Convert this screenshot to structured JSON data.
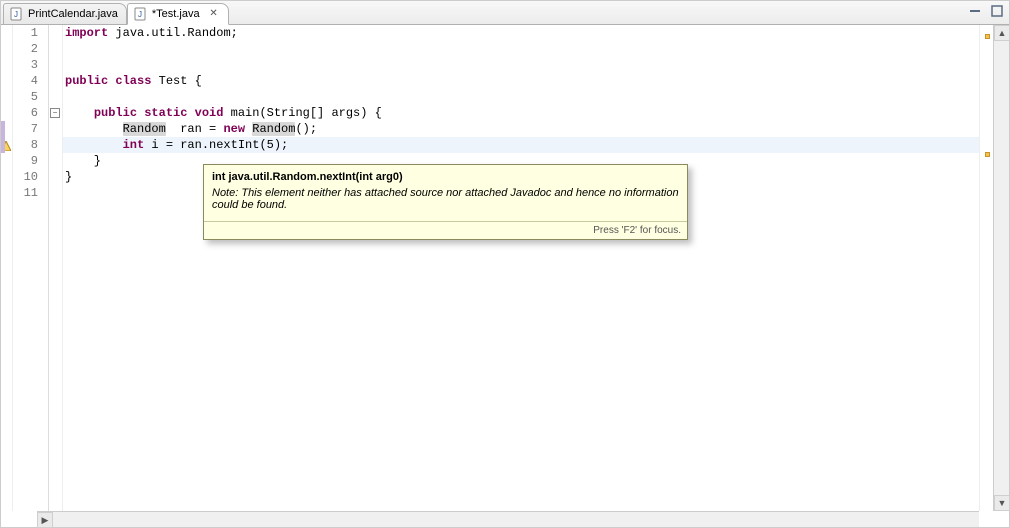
{
  "tabs": [
    {
      "label": "PrintCalendar.java",
      "active": false,
      "dirty": false,
      "closable": false
    },
    {
      "label": "*Test.java",
      "active": true,
      "dirty": true,
      "closable": true
    }
  ],
  "controls": {
    "maximize_name": "maximize-icon",
    "minimize_name": "minimize-icon"
  },
  "code": {
    "lines": [
      {
        "n": 1,
        "fold": null,
        "warn": false,
        "change": false,
        "hl": false,
        "tokens": [
          [
            "imp",
            "import "
          ],
          [
            "pkg",
            "java.util.Random"
          ],
          [
            "",
            ";"
          ]
        ]
      },
      {
        "n": 2,
        "fold": null,
        "warn": false,
        "change": false,
        "hl": false,
        "tokens": []
      },
      {
        "n": 3,
        "fold": null,
        "warn": false,
        "change": false,
        "hl": false,
        "tokens": []
      },
      {
        "n": 4,
        "fold": null,
        "warn": false,
        "change": false,
        "hl": false,
        "tokens": [
          [
            "kw",
            "public class "
          ],
          [
            "cls",
            "Test"
          ],
          [
            "",
            " {"
          ]
        ]
      },
      {
        "n": 5,
        "fold": null,
        "warn": false,
        "change": false,
        "hl": false,
        "tokens": []
      },
      {
        "n": 6,
        "fold": "minus",
        "warn": false,
        "change": false,
        "hl": false,
        "tokens": [
          [
            "",
            "    "
          ],
          [
            "kw",
            "public static void "
          ],
          [
            "",
            "main(String[] args) {"
          ]
        ]
      },
      {
        "n": 7,
        "fold": null,
        "warn": false,
        "change": true,
        "hl": false,
        "tokens": [
          [
            "",
            "        "
          ],
          [
            "occ",
            "Random"
          ],
          [
            "",
            "  ran = "
          ],
          [
            "kw",
            "new "
          ],
          [
            "occ",
            "Random"
          ],
          [
            "",
            "();"
          ]
        ]
      },
      {
        "n": 8,
        "fold": null,
        "warn": true,
        "change": true,
        "hl": true,
        "tokens": [
          [
            "",
            "        "
          ],
          [
            "kw",
            "int"
          ],
          [
            "",
            " i = ran.nextInt(5);"
          ]
        ]
      },
      {
        "n": 9,
        "fold": null,
        "warn": false,
        "change": false,
        "hl": false,
        "tokens": [
          [
            "",
            "    }"
          ]
        ]
      },
      {
        "n": 10,
        "fold": null,
        "warn": false,
        "change": false,
        "hl": false,
        "tokens": [
          [
            "",
            "}"
          ]
        ]
      },
      {
        "n": 11,
        "fold": null,
        "warn": false,
        "change": false,
        "hl": false,
        "tokens": []
      }
    ]
  },
  "tooltip": {
    "signature": "int java.util.Random.nextInt(int arg0)",
    "note": "Note: This element neither has attached source nor attached Javadoc and hence no information could be found.",
    "footer": "Press 'F2' for focus."
  },
  "overview_markers": [
    {
      "top_ratio": 0.018,
      "kind": "warn"
    },
    {
      "top_ratio": 0.26,
      "kind": "warn"
    }
  ]
}
